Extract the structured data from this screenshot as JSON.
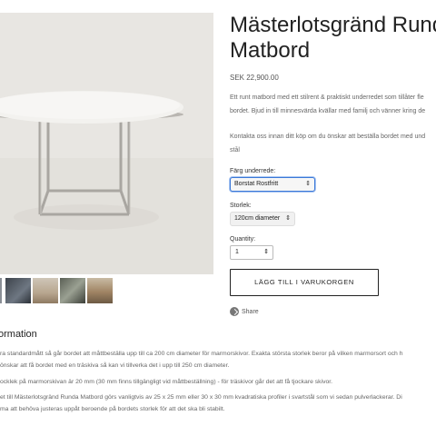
{
  "product": {
    "title_line1": "Mästerlotsgränd Rund",
    "title_line2": "Matbord",
    "price": "SEK 22,900.00",
    "description": [
      "Ett runt matbord med ett stilrent & praktiskt underredet som tillåter fle",
      "bordet. Bjud in till minnesvärda kvällar med familj och vänner kring de"
    ],
    "contact": [
      "Kontakta oss innan ditt köp om du önskar att beställa bordet med und",
      "stål"
    ]
  },
  "options": {
    "color_label": "Färg underrede:",
    "color_value": "Borstat Rostfritt",
    "size_label": "Storlek:",
    "size_value": "120cm diameter",
    "qty_label": "Quantity:",
    "qty_value": "1"
  },
  "actions": {
    "add_to_cart": "LÄGG TILL I VARUKORGEN",
    "share": "Share"
  },
  "info": {
    "heading": "ormation",
    "p1": "ra standardmått så går bordet att måttbeställa upp till ca 200 cm diameter för marmorskivor. Exakta största storlek beror på vilken marmorsort och h",
    "p1b": "önskar att få bordet med en träskiva så kan vi tillverka det i upp till 250 cm diameter.",
    "p2": "ocklek på marmorskivan är 20 mm (30 mm finns tillgängligt vid måttbeställning) - för träskivor går det att få tjockare skivor.",
    "p3": "et till Mästerlotsgränd Runda Matbord görs vanligtvis av 25 x 25 mm eller 30 x 30 mm kvadratiska profiler i svartstål som vi sedan pulverlackerar. Di",
    "p3b": "ma att behöva justeras uppåt beroende på bordets storlek för att det ska bli stabilt."
  },
  "colors": {
    "accent_focus": "#3b78d8",
    "text": "#222222",
    "muted": "#666666"
  },
  "icons": {
    "select_chevron": "chevron-updown-icon",
    "share": "share-icon"
  }
}
